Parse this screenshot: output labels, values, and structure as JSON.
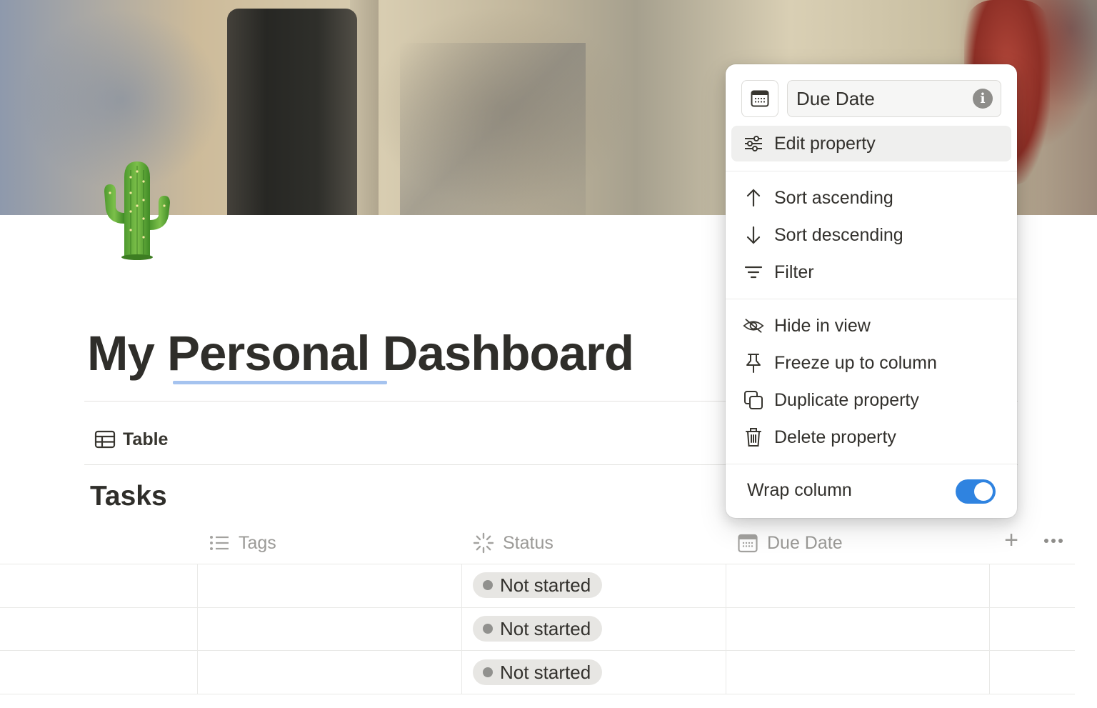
{
  "page": {
    "icon": "cactus-emoji",
    "title": "My Personal Dashboard"
  },
  "view": {
    "tab_label": "Table",
    "tab_icon": "table-icon"
  },
  "database": {
    "title": "Tasks",
    "columns": [
      {
        "label": "Tags",
        "icon": "list-icon"
      },
      {
        "label": "Status",
        "icon": "loading-spinner-icon"
      },
      {
        "label": "Due Date",
        "icon": "calendar-icon"
      }
    ],
    "rows": [
      {
        "status": "Not started"
      },
      {
        "status": "Not started"
      },
      {
        "status": "Not started"
      }
    ],
    "add_column_icon": "plus-icon",
    "more_icon": "more-horizontal-icon"
  },
  "menu": {
    "property_name": "Due Date",
    "property_type_icon": "calendar-icon",
    "info_icon": "info-icon",
    "edit_property": "Edit property",
    "sort_ascending": "Sort ascending",
    "sort_descending": "Sort descending",
    "filter": "Filter",
    "hide_in_view": "Hide in view",
    "freeze_up_to_column": "Freeze up to column",
    "duplicate_property": "Duplicate property",
    "delete_property": "Delete property",
    "wrap_column": "Wrap column",
    "wrap_column_enabled": true
  },
  "colors": {
    "toggle_on": "#2f83e0",
    "status_pill_bg": "#e7e6e3",
    "title_underline": "#a5c3ef"
  }
}
